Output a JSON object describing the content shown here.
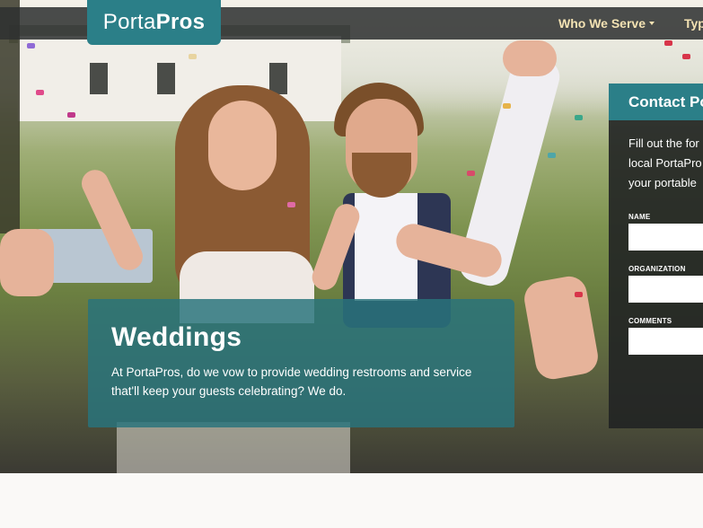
{
  "header": {
    "logo_light": "Porta",
    "logo_bold": "Pros",
    "nav": [
      {
        "label": "Who We Serve",
        "has_dropdown": true
      },
      {
        "label": "Typ",
        "has_dropdown": false
      }
    ]
  },
  "feature": {
    "title": "Weddings",
    "body": "At PortaPros, do we vow to provide wedding restrooms and service that'll keep your guests celebrating? We do."
  },
  "contact": {
    "title": "Contact Po",
    "intro_lines": [
      "Fill out the for",
      "local PortaPro",
      "your portable"
    ],
    "fields": [
      {
        "label": "NAME",
        "value": ""
      },
      {
        "label": "ORGANIZATION",
        "value": ""
      },
      {
        "label": "COMMENTS",
        "value": ""
      }
    ]
  },
  "colors": {
    "brand_teal": "#2b7f88",
    "nav_text": "#f3e2b3",
    "topbar": "#2d3030"
  }
}
